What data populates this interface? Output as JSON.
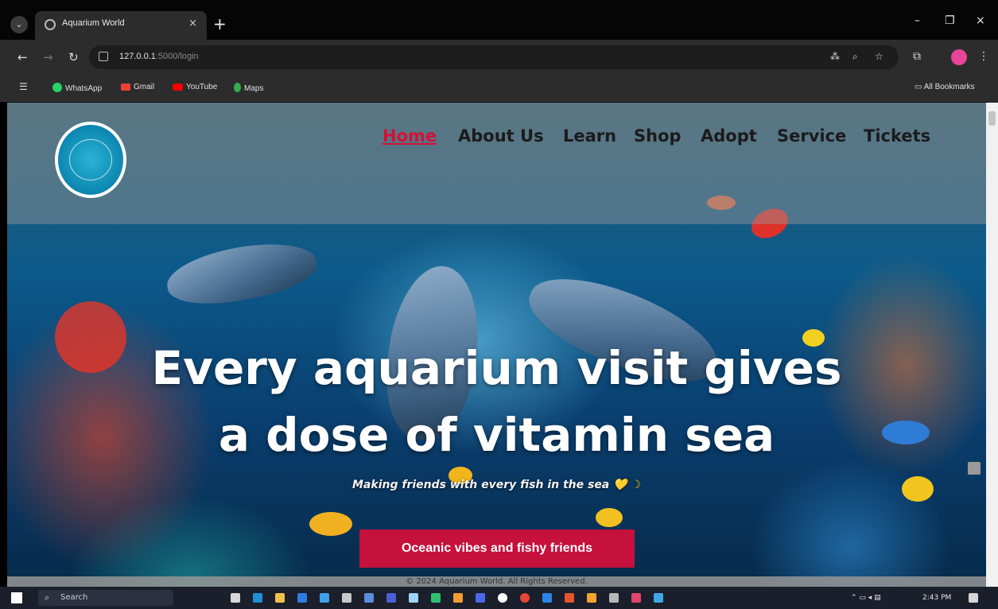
{
  "browser": {
    "tab_title": "Aquarium World",
    "tab_menu_icon": "chevron-down-icon",
    "close_glyph": "×",
    "new_tab_glyph": "+",
    "minimize_glyph": "–",
    "restore_glyph": "❐",
    "window_close_glyph": "×",
    "back_glyph": "←",
    "forward_glyph": "→",
    "reload_glyph": "↻",
    "url_host": "127.0.0.1",
    "url_path": ":5000/login",
    "bookmarks": [
      "WhatsApp",
      "Gmail",
      "YouTube",
      "Maps"
    ],
    "all_bookmarks": "All Bookmarks"
  },
  "site": {
    "nav": [
      "Home",
      "About Us",
      "Learn",
      "Shop",
      "Adopt",
      "Service",
      "Tickets"
    ],
    "hero_line1": "Every aquarium visit gives",
    "hero_line2": "a dose of vitamin sea",
    "subtitle": "Making friends with every fish in the sea",
    "subtitle_emoji": "💛 ☽",
    "cta": "Oceanic vibes and fishy friends",
    "footer": "© 2024 Aquarium World. All Rights Reserved."
  },
  "taskbar": {
    "search": "Search",
    "time": "2:43 PM"
  },
  "colors": {
    "accent_red": "#c5113c",
    "nav_active": "#d41237",
    "profile": "#e8459a"
  }
}
